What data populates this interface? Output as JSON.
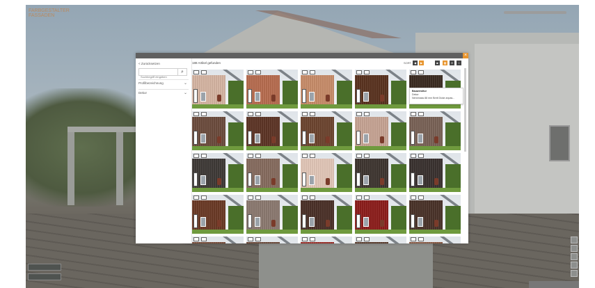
{
  "app": {
    "logo_line1": "FARBGESTALTER",
    "logo_line2": "FASSADEN"
  },
  "modal": {
    "close_label": "×",
    "back_label": "< Zurücksetzen",
    "search_placeholder": "Suchbegriff eingeben",
    "search_icon": "⌕",
    "filters": [
      {
        "label": "Profilbezeichnung",
        "chevron": "⌄"
      },
      {
        "label": "Dekor",
        "chevron": "⌄"
      }
    ],
    "result_count": "188 Artikel gefunden",
    "sort_label": "SORT",
    "toolbar_buttons": [
      "◀",
      "▶",
      "",
      "■",
      "▦",
      "✕",
      "↕"
    ],
    "tooltip": {
      "title": "Bauweroltur",
      "line2": "Dekor",
      "line3": "Nennmass 88 mm Breit Dicke anpas..."
    }
  },
  "tiles": [
    {
      "wall_color": "#d7b6a4"
    },
    {
      "wall_color": "#b86d50"
    },
    {
      "wall_color": "#c98d6a"
    },
    {
      "wall_color": "#5a3320"
    },
    {
      "wall_color": "#3c2c22"
    },
    {
      "wall_color": "#6c4c3e"
    },
    {
      "wall_color": "#5e3526"
    },
    {
      "wall_color": "#6d4530"
    },
    {
      "wall_color": "#c8a595"
    },
    {
      "wall_color": "#7a6357"
    },
    {
      "wall_color": "#3f3a37"
    },
    {
      "wall_color": "#876c5f"
    },
    {
      "wall_color": "#e3c8b9"
    },
    {
      "wall_color": "#3f3631"
    },
    {
      "wall_color": "#3a3230"
    },
    {
      "wall_color": "#6b3a26"
    },
    {
      "wall_color": "#8c7a71"
    },
    {
      "wall_color": "#4b3128"
    },
    {
      "wall_color": "#8d1e1c"
    },
    {
      "wall_color": "#4a3329"
    },
    {
      "wall_color": "#7a4e3b"
    },
    {
      "wall_color": "#6d4a3a"
    },
    {
      "wall_color": "#9b2f28"
    },
    {
      "wall_color": "#5a3b2d"
    },
    {
      "wall_color": "#8a5a44"
    }
  ],
  "colors": {
    "accent": "#e7952f",
    "modal_header": "#606060"
  }
}
